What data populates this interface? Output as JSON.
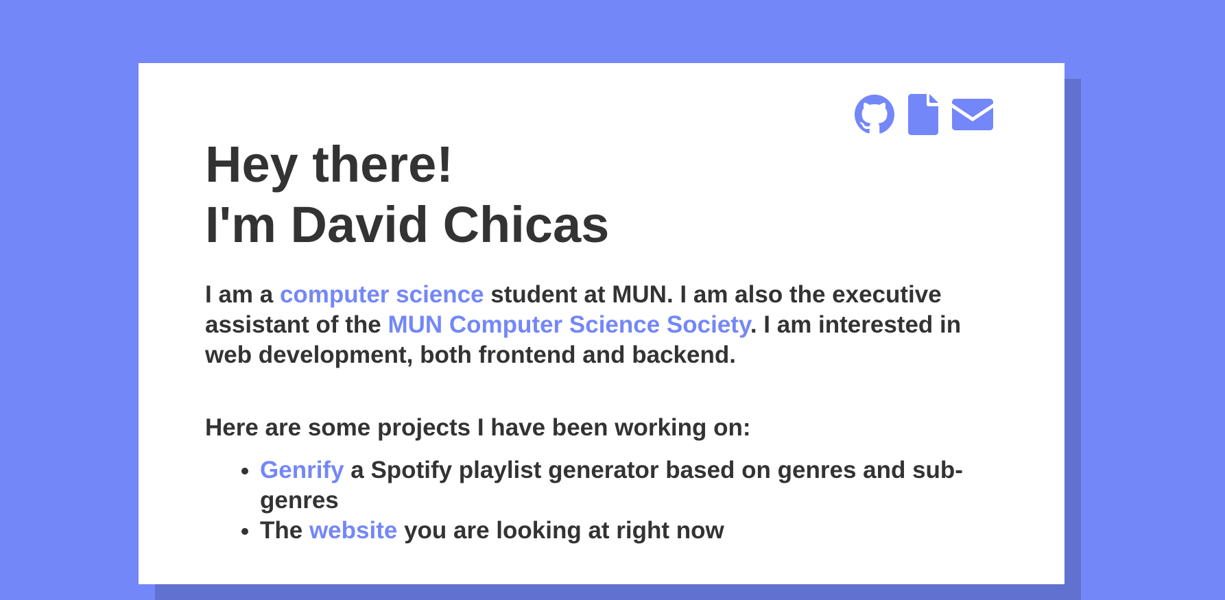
{
  "colors": {
    "background": "#7487f8",
    "card": "#ffffff",
    "card_shadow": "#6171cf",
    "text": "#333333",
    "link": "#7487f8"
  },
  "header_icons": [
    {
      "name": "github-icon"
    },
    {
      "name": "document-icon"
    },
    {
      "name": "mail-icon"
    }
  ],
  "heading": {
    "line1": "Hey there!",
    "line2": "I'm David Chicas"
  },
  "intro": {
    "part1": "I am a ",
    "link1": "computer science",
    "part2": " student at MUN. I am also the executive assistant of the ",
    "link2": "MUN Computer Science Society",
    "part3": ". I am interested in web development, both frontend and backend."
  },
  "projects": {
    "heading": "Here are some projects I have been working on:",
    "items": [
      {
        "prefix": "",
        "link": "Genrify",
        "suffix": " a Spotify playlist generator based on genres and sub-genres"
      },
      {
        "prefix": "The ",
        "link": "website",
        "suffix": " you are looking at right now"
      }
    ]
  }
}
